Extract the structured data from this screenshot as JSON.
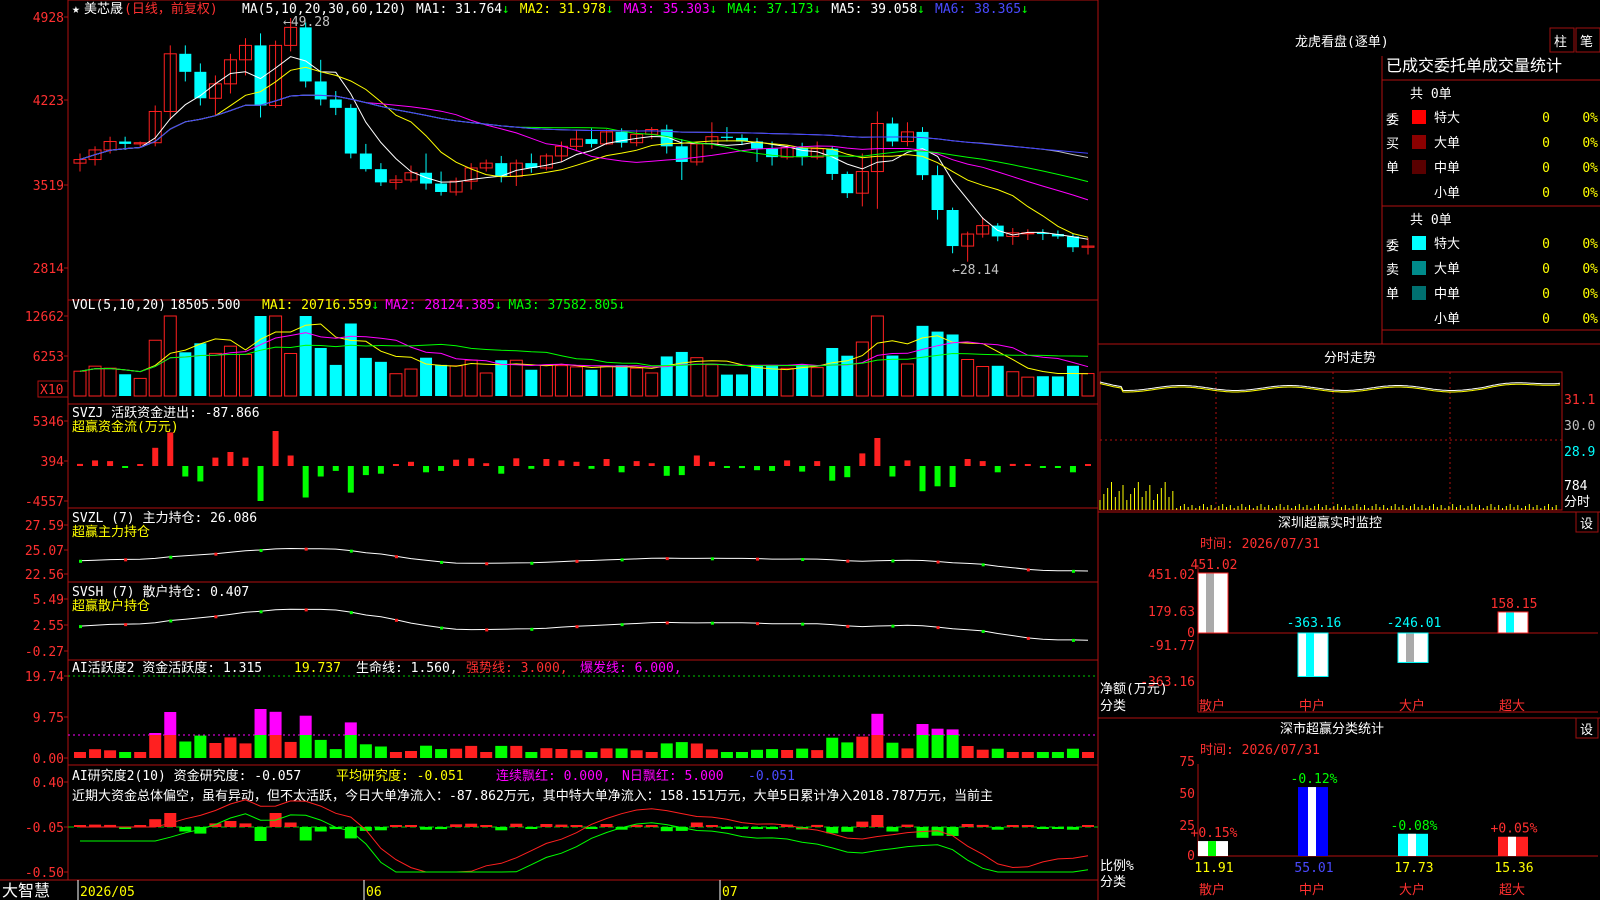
{
  "stock": {
    "name": "美芯晟",
    "period_note": "(日线，前复权)",
    "star": "★"
  },
  "main": {
    "ma_header": "MA(5,10,20,30,60,120)",
    "ma_values": [
      {
        "label": "MA1: 31.764",
        "color": "#ffffff",
        "arrow": "↓"
      },
      {
        "label": "MA2: 31.978",
        "color": "#ffff00",
        "arrow": "↓"
      },
      {
        "label": "MA3: 35.303",
        "color": "#ff00ff",
        "arrow": "↓"
      },
      {
        "label": "MA4: 37.173",
        "color": "#00ff00",
        "arrow": "↓"
      },
      {
        "label": "MA5: 39.058",
        "color": "#ffffff",
        "arrow": "↓"
      },
      {
        "label": "MA6: 38.365",
        "color": "#4a4aff",
        "arrow": "↓"
      }
    ],
    "yticks": [
      "4928",
      "4223",
      "3519",
      "2814"
    ],
    "high_label": "←49.28",
    "low_label": "←28.14"
  },
  "vol": {
    "header": "VOL(5,10,20)",
    "value": "18505.500",
    "ma": [
      {
        "label": "MA1: 20716.559",
        "color": "#ffff00"
      },
      {
        "label": "MA2: 28124.385",
        "color": "#ff00ff"
      },
      {
        "label": "MA3: 37582.805",
        "color": "#00ff00"
      }
    ],
    "yticks": [
      "12662",
      "6253"
    ],
    "unit": "X10"
  },
  "svzj": {
    "header": "SVZJ  活跃资金进出: -87.866",
    "subtitle": "超赢资金流(万元)",
    "yticks": [
      "5346",
      "394",
      "-4557"
    ]
  },
  "svzl": {
    "header": "SVZL (7) 主力持仓: 26.086",
    "subtitle": "超赢主力持仓",
    "yticks": [
      "27.59",
      "25.07",
      "22.56"
    ]
  },
  "svsh": {
    "header": "SVSH (7) 散户持仓: 0.407",
    "subtitle": "超赢散户持仓",
    "yticks": [
      "5.49",
      "2.55",
      "-0.27"
    ]
  },
  "ai_act": {
    "title": "AI活跃度2 资金活跃度: 1.315",
    "v2": "19.737",
    "v3": "生命线: 1.560,",
    "v4": "强势线: 3.000,",
    "v5": "爆发线: 6.000,",
    "yticks": [
      "19.74",
      "9.75",
      "0.00"
    ]
  },
  "ai_res": {
    "title": "AI研究度2(10) 资金研究度: -0.057",
    "avg": "平均研究度: -0.051",
    "lian": "连续飘红: 0.000,",
    "nday": "N日飘红: 5.000",
    "last": "-0.051",
    "comment": "近期大资金总体偏空，虽有异动，但不太活跃，今日大单净流入：-87.862万元，其中特大单净流入：158.151万元，大单5日累计净入2018.787万元，当前主",
    "yticks": [
      "0.40",
      "-0.05",
      "-0.50"
    ]
  },
  "xaxis": {
    "labels": [
      "2026/05",
      "06",
      "07"
    ]
  },
  "brand": "大智慧",
  "right": {
    "lhb_title": "龙虎看盘(逐单)",
    "btn_bar": "柱",
    "btn_pen": "笔",
    "stat_title": "已成交委托单成交量统计",
    "buy_label": "委买单",
    "sell_label": "委卖单",
    "buy_total": "共 0单",
    "sell_total": "共 0单",
    "buy_rows": [
      {
        "name": "特大",
        "v": "0",
        "p": "0%",
        "color": "#ff0000"
      },
      {
        "name": "大单",
        "v": "0",
        "p": "0%",
        "color": "#8b0000"
      },
      {
        "name": "中单",
        "v": "0",
        "p": "0%",
        "color": "#5a0000"
      },
      {
        "name": "小单",
        "v": "0",
        "p": "0%",
        "color": ""
      }
    ],
    "sell_rows": [
      {
        "name": "特大",
        "v": "0",
        "p": "0%",
        "color": "#00ffff"
      },
      {
        "name": "大单",
        "v": "0",
        "p": "0%",
        "color": "#008b8b"
      },
      {
        "name": "中单",
        "v": "0",
        "p": "0%",
        "color": "#007070"
      },
      {
        "name": "小单",
        "v": "0",
        "p": "0%",
        "color": ""
      }
    ],
    "fs_title": "分时走势",
    "fs_yticks": [
      "31.1",
      "30.0",
      "28.9"
    ],
    "fs_vol_label": "784",
    "fs_unit": "分时",
    "sz_title": "深圳超赢实时监控",
    "sz_btn": "设",
    "sz_time": "时间: 2026/07/31",
    "sz_yticks": [
      "451.02",
      "179.63",
      "0",
      "-91.77",
      "-363.16"
    ],
    "sz_ylabel": "净额(万元)",
    "sz_xlabel": "分类",
    "sz_cats": [
      "散户",
      "中户",
      "大户",
      "超大"
    ],
    "sz_values": [
      "451.02",
      "-363.16",
      "-246.01",
      "158.15"
    ],
    "ss_title": "深市超赢分类统计",
    "ss_btn": "设",
    "ss_time": "时间: 2026/07/31",
    "ss_yticks": [
      "75",
      "50",
      "25",
      "0"
    ],
    "ss_ylabel": "比例%",
    "ss_xlabel": "分类",
    "ss_cats": [
      "散户",
      "中户",
      "大户",
      "超大"
    ],
    "ss_changes": [
      "+0.15%",
      "-0.12%",
      "-0.08%",
      "+0.05%"
    ],
    "ss_values": [
      "11.91",
      "55.01",
      "17.73",
      "15.36"
    ]
  },
  "colors": {
    "up": "#ff2020",
    "down": "#00ffff",
    "frame": "#b01010",
    "ma1": "#ffffff",
    "ma2": "#ffff00",
    "ma3": "#ff00ff",
    "ma4": "#00ff00",
    "ma5": "#c0c0c0",
    "ma6": "#4040ff"
  },
  "chart_data": {
    "type": "candlestick",
    "title": "美芯晟 (日线，前复权)",
    "ylim": [
      28.14,
      49.28
    ],
    "ohlc_approx": [
      [
        37.2,
        38.0,
        36.5,
        37.5
      ],
      [
        37.5,
        38.6,
        37.0,
        38.3
      ],
      [
        38.3,
        39.4,
        38.0,
        39.0
      ],
      [
        39.0,
        39.4,
        38.3,
        38.8
      ],
      [
        38.8,
        39.0,
        38.5,
        38.9
      ],
      [
        38.9,
        42.0,
        38.6,
        41.5
      ],
      [
        41.5,
        47.0,
        40.8,
        46.3
      ],
      [
        46.3,
        47.0,
        44.0,
        44.8
      ],
      [
        44.8,
        45.5,
        42.0,
        42.6
      ],
      [
        42.6,
        44.5,
        41.2,
        43.8
      ],
      [
        43.8,
        46.3,
        43.0,
        45.8
      ],
      [
        45.8,
        47.6,
        44.5,
        47.0
      ],
      [
        47.0,
        48.0,
        41.0,
        42.0
      ],
      [
        42.0,
        47.4,
        41.8,
        47.0
      ],
      [
        47.0,
        49.28,
        46.5,
        48.5
      ],
      [
        48.5,
        48.9,
        43.5,
        44.0
      ],
      [
        44.0,
        45.8,
        42.0,
        42.5
      ],
      [
        42.5,
        43.2,
        41.2,
        41.8
      ],
      [
        41.8,
        42.1,
        37.6,
        38.0
      ],
      [
        38.0,
        38.8,
        36.5,
        36.7
      ],
      [
        36.7,
        37.2,
        35.3,
        35.6
      ],
      [
        35.6,
        36.2,
        35.0,
        35.8
      ],
      [
        35.8,
        37.0,
        35.6,
        36.4
      ],
      [
        36.4,
        38.0,
        35.0,
        35.5
      ],
      [
        35.5,
        36.5,
        34.5,
        34.8
      ],
      [
        34.8,
        36.0,
        34.5,
        35.7
      ],
      [
        35.7,
        37.2,
        35.0,
        36.8
      ],
      [
        36.8,
        37.5,
        36.5,
        37.2
      ],
      [
        37.2,
        37.8,
        35.6,
        36.1
      ],
      [
        36.1,
        37.5,
        35.3,
        37.2
      ],
      [
        37.2,
        38.0,
        36.4,
        36.8
      ],
      [
        36.8,
        38.0,
        36.6,
        37.8
      ],
      [
        37.8,
        39.0,
        37.3,
        38.6
      ],
      [
        38.6,
        40.0,
        38.2,
        39.2
      ],
      [
        39.2,
        40.1,
        38.5,
        38.8
      ],
      [
        38.8,
        40.0,
        38.7,
        39.8
      ],
      [
        39.8,
        40.1,
        38.5,
        38.9
      ],
      [
        38.9,
        40.0,
        38.6,
        39.6
      ],
      [
        39.6,
        40.2,
        39.2,
        40.0
      ],
      [
        40.0,
        40.4,
        38.0,
        38.6
      ],
      [
        38.6,
        39.2,
        35.8,
        37.3
      ],
      [
        37.3,
        39.0,
        37.0,
        38.8
      ],
      [
        38.8,
        40.6,
        38.4,
        39.4
      ],
      [
        39.4,
        40.2,
        39.0,
        39.3
      ],
      [
        39.3,
        39.6,
        38.7,
        39.0
      ],
      [
        39.0,
        39.3,
        37.3,
        38.4
      ],
      [
        38.4,
        39.0,
        37.0,
        37.7
      ],
      [
        37.7,
        38.7,
        37.5,
        38.5
      ],
      [
        38.5,
        38.9,
        37.0,
        37.7
      ],
      [
        37.7,
        39.0,
        37.5,
        38.4
      ],
      [
        38.4,
        38.6,
        35.8,
        36.3
      ],
      [
        36.3,
        36.5,
        34.3,
        34.7
      ],
      [
        34.7,
        38.0,
        33.6,
        36.5
      ],
      [
        36.5,
        41.5,
        33.4,
        40.5
      ],
      [
        40.5,
        41.0,
        38.6,
        39.0
      ],
      [
        39.0,
        40.6,
        38.6,
        39.8
      ],
      [
        39.8,
        40.2,
        35.8,
        36.2
      ],
      [
        36.2,
        37.0,
        32.5,
        33.3
      ],
      [
        33.3,
        33.5,
        29.7,
        30.3
      ],
      [
        30.3,
        31.5,
        29.0,
        31.3
      ],
      [
        31.3,
        32.7,
        31.0,
        32.0
      ],
      [
        32.0,
        32.2,
        30.7,
        31.1
      ],
      [
        31.1,
        31.8,
        30.4,
        31.4
      ],
      [
        31.4,
        31.7,
        30.8,
        31.4
      ],
      [
        31.4,
        31.7,
        30.8,
        31.3
      ],
      [
        31.3,
        31.6,
        30.9,
        31.1
      ],
      [
        31.1,
        31.3,
        29.8,
        30.2
      ],
      [
        30.2,
        31.0,
        29.6,
        30.3
      ]
    ],
    "x_labels": [
      "2026/05",
      "06",
      "07"
    ]
  }
}
